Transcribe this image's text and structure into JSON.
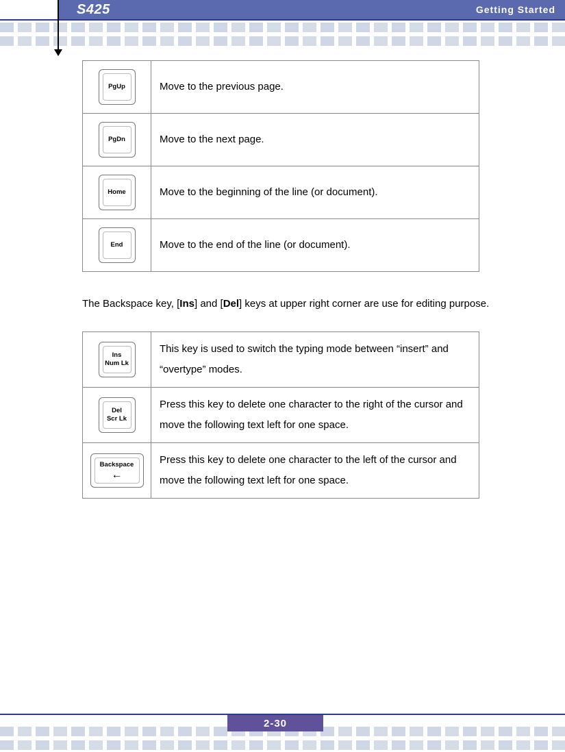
{
  "header": {
    "model": "S425",
    "section": "Getting  Started"
  },
  "navkeys": [
    {
      "label": "PgUp",
      "desc": "Move to the previous page."
    },
    {
      "label": "PgDn",
      "desc": "Move to the next page."
    },
    {
      "label": "Home",
      "desc": "Move to the beginning of the line (or document)."
    },
    {
      "label": "End",
      "desc": "Move to the end of the line (or document)."
    }
  ],
  "para": {
    "pre": "The Backspace key, [",
    "b1": "Ins",
    "mid1": "] and [",
    "b2": "Del",
    "post": "] keys at upper right corner are use for editing purpose."
  },
  "editkeys": [
    {
      "label1": "Ins",
      "label2": "Num Lk",
      "wide": false,
      "desc": "This key is used to switch the typing mode between “insert” and “overtype” modes."
    },
    {
      "label1": "Del",
      "label2": "Scr Lk",
      "wide": false,
      "desc": "Press this key to delete one character to the right of the cursor and move the following text left for one space."
    },
    {
      "label1": "Backspace",
      "arrow": "←",
      "wide": true,
      "desc": "Press this key to delete one character to the left of the cursor and move the following text left for one space."
    }
  ],
  "page_number": "2-30"
}
